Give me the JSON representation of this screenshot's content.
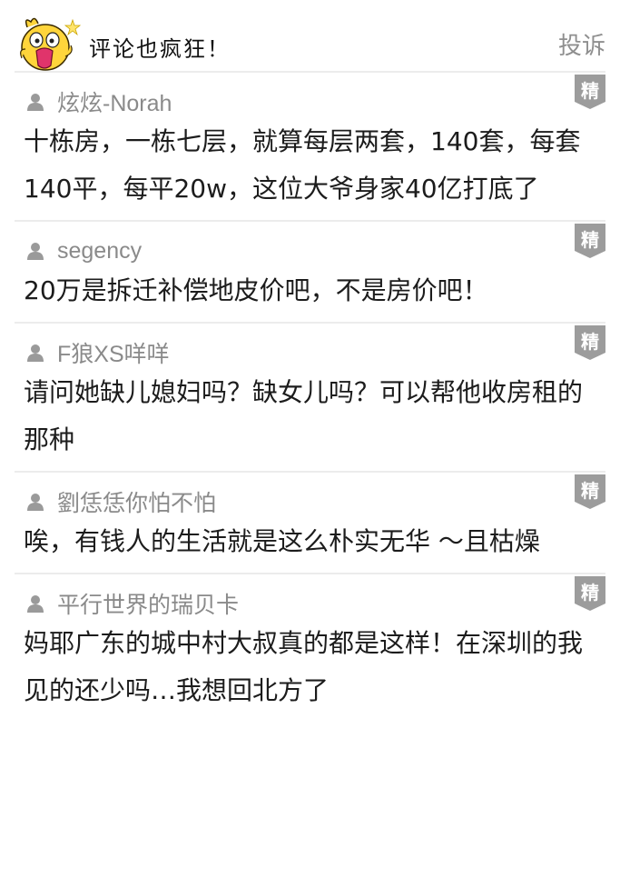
{
  "header": {
    "title": "评论也疯狂！",
    "report_label": "投诉"
  },
  "badge_label": "精",
  "comments": [
    {
      "user": "炫炫-Norah",
      "text": "十栋房，一栋七层，就算每层两套，140套，每套140平，每平20w，这位大爷身家40亿打底了"
    },
    {
      "user": "segency",
      "text": "20万是拆迁补偿地皮价吧，不是房价吧！"
    },
    {
      "user": "F狼XS咩咩",
      "text": "请问她缺儿媳妇吗？缺女儿吗？可以帮他收房租的那种"
    },
    {
      "user": "劉恁恁你怕不怕",
      "text": "唉，有钱人的生活就是这么朴实无华 ～且枯燥"
    },
    {
      "user": "平行世界的瑞贝卡",
      "text": "妈耶广东的城中村大叔真的都是这样！在深圳的我见的还少吗…我想回北方了"
    }
  ],
  "colors": {
    "badge_bg": "#9c9c9c",
    "divider": "#ececec",
    "username": "#8a8a8a",
    "mascot_yellow": "#ffd53b"
  }
}
